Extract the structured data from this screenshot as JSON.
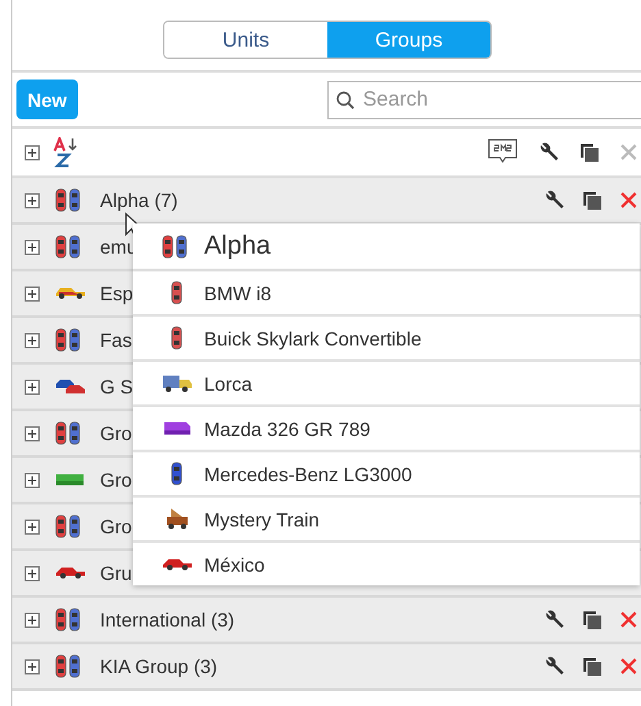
{
  "tabs": [
    {
      "label": "Units",
      "selected": false
    },
    {
      "label": "Groups",
      "selected": true
    }
  ],
  "toolbar": {
    "new_button": "New",
    "search": {
      "placeholder": "Search"
    }
  },
  "list_header": {
    "actions": [
      {
        "kind": "sms"
      },
      {
        "kind": "settings"
      },
      {
        "kind": "copy"
      },
      {
        "kind": "delete",
        "disabled": true
      }
    ]
  },
  "groups": [
    {
      "name": "Alpha (7)"
    },
    {
      "name": "emu"
    },
    {
      "name": "Esp"
    },
    {
      "name": "Fas"
    },
    {
      "name": "G S"
    },
    {
      "name": "Gro"
    },
    {
      "name": "Gro"
    },
    {
      "name": "Gro"
    },
    {
      "name": "Gru"
    },
    {
      "name": "International (3)"
    },
    {
      "name": "KIA Group (3)"
    }
  ],
  "popup": {
    "title": "Alpha",
    "units": [
      "BMW i8",
      "Buick Skylark Convertible",
      "Lorca",
      "Mazda 326 GR 789",
      "Mercedes-Benz LG3000",
      "Mystery Train",
      "México"
    ]
  }
}
